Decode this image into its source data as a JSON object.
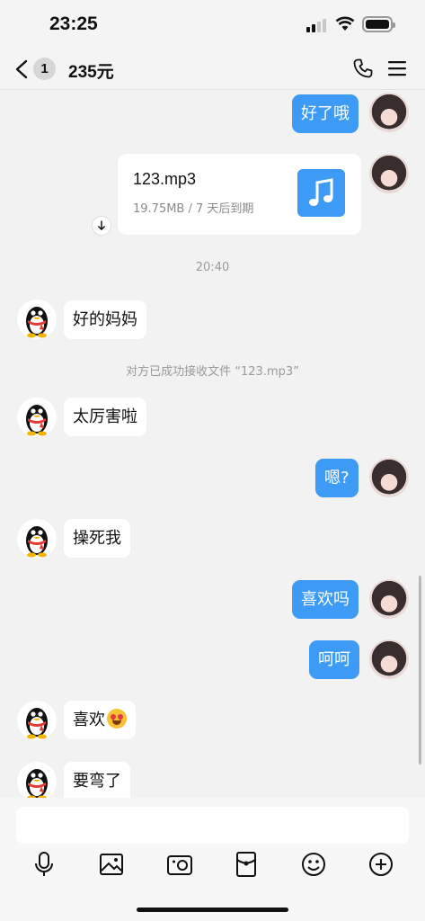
{
  "status_bar": {
    "time": "23:25"
  },
  "nav": {
    "unread_count": "1",
    "title": "235元"
  },
  "messages": [
    {
      "text": "好了哦"
    },
    {
      "file_name": "123.mp3",
      "file_meta": "19.75MB / 7 天后到期"
    },
    {
      "text": "20:40"
    },
    {
      "text": "好的妈妈"
    },
    {
      "text": "对方已成功接收文件 “123.mp3”"
    },
    {
      "text": "太厉害啦"
    },
    {
      "text": "嗯?"
    },
    {
      "text": "操死我"
    },
    {
      "text": "喜欢吗"
    },
    {
      "text": "呵呵"
    },
    {
      "text": "喜欢",
      "emoji": "heart-eyes-emoji"
    },
    {
      "text": "要弯了"
    }
  ],
  "colors": {
    "outgoing_bubble": "#3d9bf5",
    "incoming_bubble": "#ffffff",
    "background": "#f2f2f2"
  },
  "toolbar": [
    "mic-icon",
    "image-icon",
    "camera-icon",
    "red-packet-icon",
    "emoji-icon",
    "plus-icon"
  ]
}
